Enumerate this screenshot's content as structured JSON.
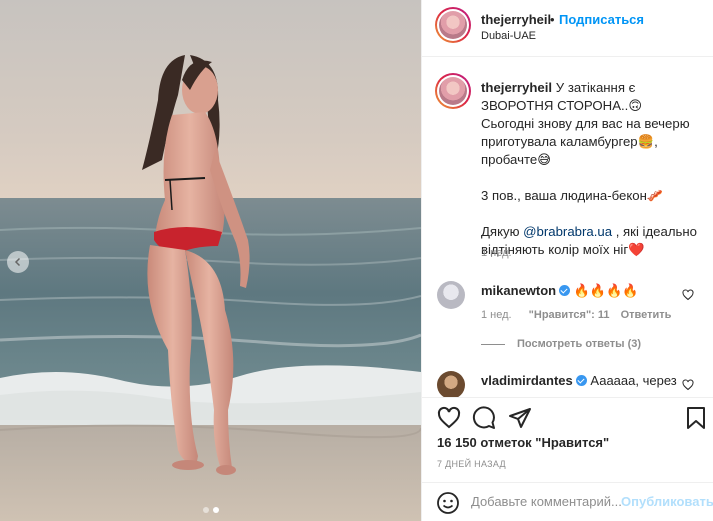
{
  "post": {
    "author": "thejerryheil",
    "separator": "•",
    "follow_label": "Подписаться",
    "location": "Dubai-UAE"
  },
  "caption": {
    "username": "thejerryheil",
    "line1_text": "У затікання є ЗВОРОТНЯ СТОРОНА..",
    "line1_emoji": "🙃",
    "line2_text": "Сьогодні знову для вас на вечерю приготувала каламбургер",
    "line2_emoji": "🍔",
    "line3_text": ", пробачте",
    "line3_emoji": "😅",
    "line4_text": "3 пов., ваша людина-бекон",
    "line4_emoji": "🥓",
    "line5_prefix": "Дякую ",
    "mention": "@brabrabra.ua",
    "line5_suffix": " , які ідеально відтіняють колір моїх ніг",
    "line5_emoji": "❤️",
    "time": "1 нед."
  },
  "comments": [
    {
      "username": "mikanewton",
      "text": "🔥🔥🔥🔥",
      "time": "1 нед.",
      "likes": "\"Нравится\": 11",
      "reply_label": "Ответить"
    },
    {
      "username": "vladimirdantes",
      "text": "Аааааа, через"
    }
  ],
  "view_replies": "Посмотреть ответы (3)",
  "likes_count": "16 150 отметок \"Нравится\"",
  "date": "7 ДНЕЙ НАЗАД",
  "comment_input": {
    "placeholder": "Добавьте комментарий...",
    "post_label": "Опубликовать"
  },
  "icons": {
    "like": "heart-icon",
    "comment": "comment-bubble-icon",
    "share": "paper-plane-icon",
    "save": "bookmark-icon",
    "emoji": "smiley-icon",
    "nav": "chevron-left-icon"
  },
  "colors": {
    "accent": "#0095f6",
    "verified": "#3897f0",
    "muted": "#8e8e8e",
    "post_disabled": "#b2dffc"
  }
}
